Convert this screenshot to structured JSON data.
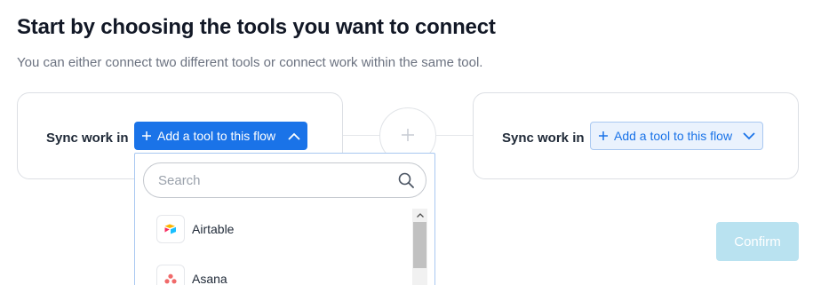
{
  "header": {
    "title": "Start by choosing the tools you want to connect",
    "subtitle": "You can either connect two different tools or connect work within the same tool."
  },
  "left_card": {
    "label": "Sync work in",
    "button_label": "Add a tool to this flow",
    "button_icon": "plus-icon",
    "chevron_icon": "chevron-up-icon"
  },
  "center": {
    "icon": "plus-icon"
  },
  "right_card": {
    "label": "Sync work in",
    "button_label": "Add a tool to this flow",
    "button_icon": "plus-icon",
    "chevron_icon": "chevron-down-icon"
  },
  "dropdown": {
    "search_placeholder": "Search",
    "search_value": "",
    "items": [
      {
        "label": "Airtable",
        "icon": "airtable-logo-icon"
      },
      {
        "label": "Asana",
        "icon": "asana-logo-icon"
      }
    ]
  },
  "actions": {
    "confirm_label": "Confirm"
  },
  "colors": {
    "accent": "#1a73e8",
    "accent_light_bg": "#eaf2fd",
    "confirm_disabled": "#b9e2f0",
    "border": "#dcdfe4"
  }
}
